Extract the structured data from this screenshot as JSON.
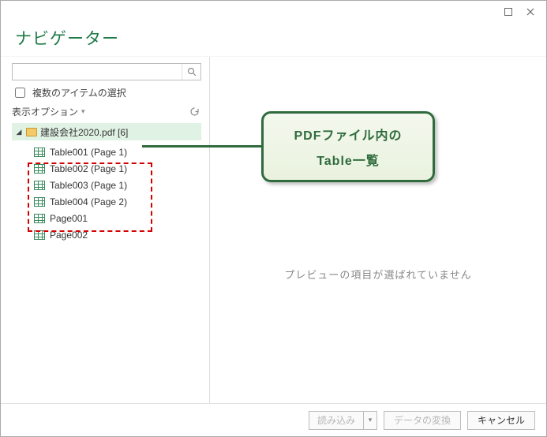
{
  "window": {
    "title": "ナビゲーター"
  },
  "left": {
    "search_placeholder": "",
    "multi_label": "複数のアイテムの選択",
    "display_options_label": "表示オプション",
    "root_label": "建設会社2020.pdf [6]",
    "items": [
      {
        "label": "Table001 (Page 1)",
        "highlight": true
      },
      {
        "label": "Table002 (Page 1)",
        "highlight": true
      },
      {
        "label": "Table003 (Page 1)",
        "highlight": true
      },
      {
        "label": "Table004 (Page 2)",
        "highlight": true
      },
      {
        "label": "Page001",
        "highlight": false
      },
      {
        "label": "Page002",
        "highlight": false
      }
    ]
  },
  "callout": {
    "line1": "PDFファイル内の",
    "line2": "Table一覧"
  },
  "preview": {
    "empty_text": "プレビューの項目が選ばれていません"
  },
  "footer": {
    "load": "読み込み",
    "transform": "データの変換",
    "cancel": "キャンセル"
  }
}
